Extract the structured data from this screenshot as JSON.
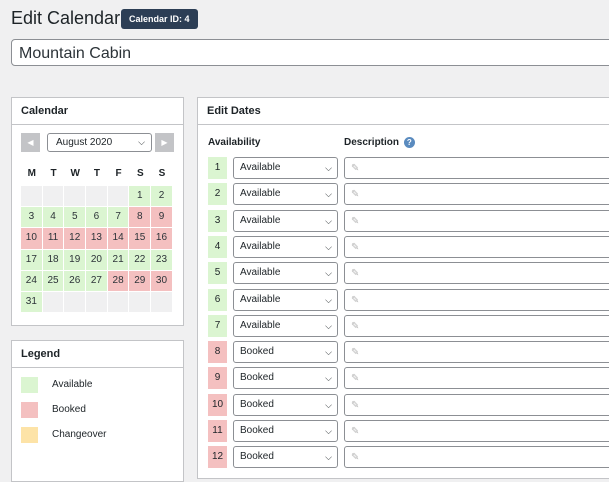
{
  "page": {
    "title": "Edit Calendar",
    "badge": "Calendar ID: 4"
  },
  "calendar_title": "Mountain Cabin",
  "calendar_box": {
    "heading": "Calendar",
    "month": "August 2020",
    "weekdays": [
      "M",
      "T",
      "W",
      "T",
      "F",
      "S",
      "S"
    ],
    "weeks": [
      [
        {
          "d": "",
          "s": "empty"
        },
        {
          "d": "",
          "s": "empty"
        },
        {
          "d": "",
          "s": "empty"
        },
        {
          "d": "",
          "s": "empty"
        },
        {
          "d": "",
          "s": "empty"
        },
        {
          "d": "1",
          "s": "available"
        },
        {
          "d": "2",
          "s": "available"
        }
      ],
      [
        {
          "d": "3",
          "s": "available"
        },
        {
          "d": "4",
          "s": "available"
        },
        {
          "d": "5",
          "s": "available"
        },
        {
          "d": "6",
          "s": "available"
        },
        {
          "d": "7",
          "s": "available"
        },
        {
          "d": "8",
          "s": "booked"
        },
        {
          "d": "9",
          "s": "booked"
        }
      ],
      [
        {
          "d": "10",
          "s": "booked"
        },
        {
          "d": "11",
          "s": "booked"
        },
        {
          "d": "12",
          "s": "booked"
        },
        {
          "d": "13",
          "s": "booked"
        },
        {
          "d": "14",
          "s": "booked"
        },
        {
          "d": "15",
          "s": "booked"
        },
        {
          "d": "16",
          "s": "booked"
        }
      ],
      [
        {
          "d": "17",
          "s": "available"
        },
        {
          "d": "18",
          "s": "available"
        },
        {
          "d": "19",
          "s": "available"
        },
        {
          "d": "20",
          "s": "available"
        },
        {
          "d": "21",
          "s": "available"
        },
        {
          "d": "22",
          "s": "available"
        },
        {
          "d": "23",
          "s": "available"
        }
      ],
      [
        {
          "d": "24",
          "s": "available"
        },
        {
          "d": "25",
          "s": "available"
        },
        {
          "d": "26",
          "s": "available"
        },
        {
          "d": "27",
          "s": "available"
        },
        {
          "d": "28",
          "s": "booked"
        },
        {
          "d": "29",
          "s": "booked"
        },
        {
          "d": "30",
          "s": "booked"
        }
      ],
      [
        {
          "d": "31",
          "s": "available"
        },
        {
          "d": "",
          "s": "empty"
        },
        {
          "d": "",
          "s": "empty"
        },
        {
          "d": "",
          "s": "empty"
        },
        {
          "d": "",
          "s": "empty"
        },
        {
          "d": "",
          "s": "empty"
        },
        {
          "d": "",
          "s": "empty"
        }
      ]
    ]
  },
  "legend": {
    "heading": "Legend",
    "items": [
      {
        "label": "Available",
        "color": "#dbf5d1"
      },
      {
        "label": "Booked",
        "color": "#f4c0c0"
      },
      {
        "label": "Changeover",
        "color": "#fde3a7"
      }
    ]
  },
  "edit_dates": {
    "heading": "Edit Dates",
    "col_availability": "Availability",
    "col_description": "Description",
    "rows": [
      {
        "day": "1",
        "status": "Available",
        "state": "available"
      },
      {
        "day": "2",
        "status": "Available",
        "state": "available"
      },
      {
        "day": "3",
        "status": "Available",
        "state": "available"
      },
      {
        "day": "4",
        "status": "Available",
        "state": "available"
      },
      {
        "day": "5",
        "status": "Available",
        "state": "available"
      },
      {
        "day": "6",
        "status": "Available",
        "state": "available"
      },
      {
        "day": "7",
        "status": "Available",
        "state": "available"
      },
      {
        "day": "8",
        "status": "Booked",
        "state": "booked"
      },
      {
        "day": "9",
        "status": "Booked",
        "state": "booked"
      },
      {
        "day": "10",
        "status": "Booked",
        "state": "booked"
      },
      {
        "day": "11",
        "status": "Booked",
        "state": "booked"
      },
      {
        "day": "12",
        "status": "Booked",
        "state": "booked"
      }
    ]
  },
  "colors": {
    "available": "#dbf5d1",
    "booked": "#f4c0c0",
    "changeover": "#fde3a7",
    "badge": "#2c3e55"
  },
  "icons": {
    "prev": "triangle-left-icon",
    "next": "triangle-right-icon",
    "dropdown": "chevron-down-icon",
    "help": "question-icon",
    "edit": "pencil-icon"
  }
}
